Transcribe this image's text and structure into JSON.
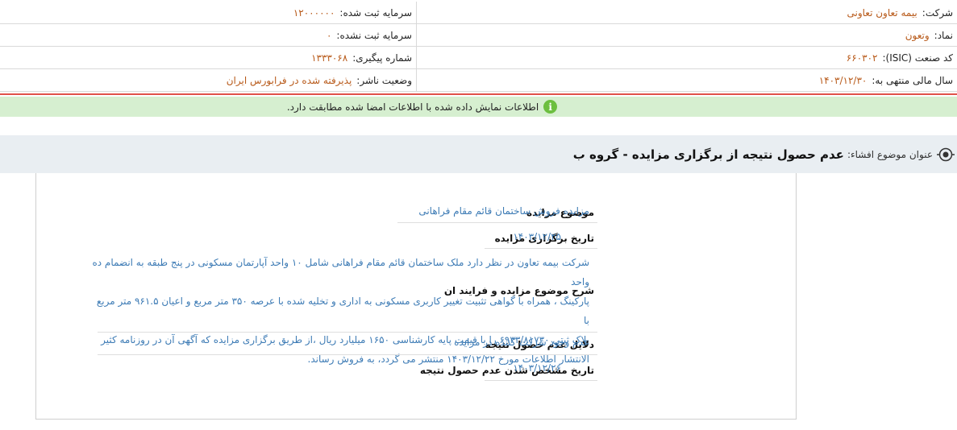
{
  "header": {
    "company_label": "شرکت:",
    "company_value": "بیمه تعاون تعاونی",
    "registered_capital_label": "سرمایه ثبت شده:",
    "registered_capital_value": "۱۲۰۰۰۰۰۰",
    "symbol_label": "نماد:",
    "symbol_value": "وتعون",
    "unregistered_capital_label": "سرمایه ثبت نشده:",
    "unregistered_capital_value": "۰",
    "isic_label": "کد صنعت (ISIC):",
    "isic_value": "۶۶۰۳۰۲",
    "tracking_label": "شماره پیگیری:",
    "tracking_value": "۱۳۳۳۰۶۸",
    "fiscal_label": "سال مالی منتهی به:",
    "fiscal_value": "۱۴۰۳/۱۲/۳۰",
    "publisher_status_label": "وضعیت ناشر:",
    "publisher_status_value": "پذیرفته شده در فرابورس ایران"
  },
  "notice": {
    "icon": "info-icon",
    "text": "اطلاعات نمایش داده شده با اطلاعات امضا شده مطابقت دارد."
  },
  "title": {
    "label": "عنوان موضوع افشاء:",
    "value": "عدم حصول نتیجه از برگزاری مزایده - گروه ب"
  },
  "fields": {
    "subject_label": "موضوع مزایده",
    "subject_value": "مزایده فروش ساختمان قائم مقام فراهانی",
    "date_label": "تاریخ برگزاری مزایده",
    "date_value": "۱۴۰۳/۱۲/۲۵",
    "desc_label": "شرح موضوع مزایده و فرایند ان",
    "desc_lines": [
      "شرکت بیمه تعاون در نظر دارد ملک ساختمان قائم مقام فراهانی شامل ۱۰ واحد آپارتمان مسکونی در پنج طبقه به انضمام ده واحد",
      "پارکینگ ، همراه با گواهی تثبیت تغییر کاربری مسکونی به اداری و تخلیه شده با عرصه ۳۵۰ متر مربع و اعیان ۹۶۱.۵ متر مربع با",
      "پلاک ثبتی ۶۹۳۳/۸۱۷۳۰ را با قیمت پایه کارشناسی ۱۶۵۰ میلیارد ریال ،از طریق برگزاری مزایده که آگهی آن در روزنامه کثیر",
      "الانتشار اطلاعات مورخ ۱۴۰۳/۱۲/۲۲ منتشر می گردد، به فروش رساند."
    ],
    "reasons_label": "دلایل عدم حصول نتیجه",
    "reasons_value": "عدم وجود شرکت کننده در مزایده",
    "result_date_label": "تاریخ مشخص شدن عدم حصول نتیجه",
    "result_date_value": "۱۴۰۳/۱۲/۲۶"
  }
}
